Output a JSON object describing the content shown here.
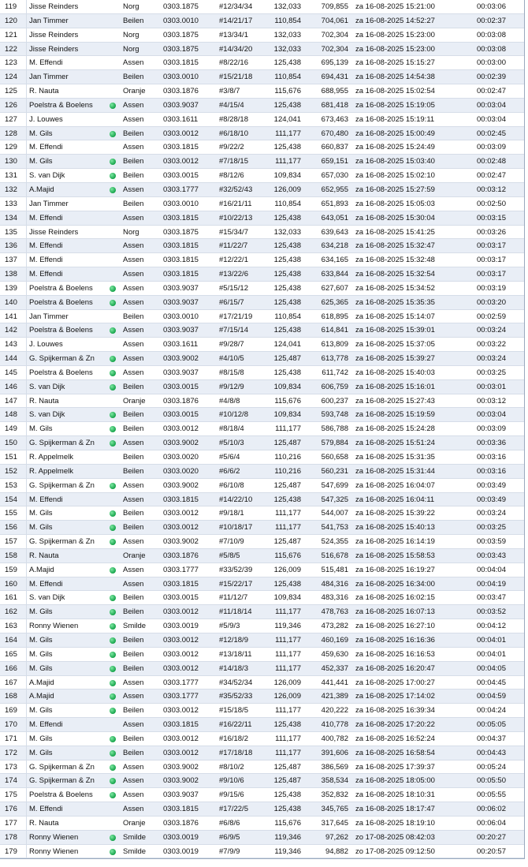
{
  "colors": {
    "row_alt": "#e9eef6",
    "row_base": "#ffffff",
    "dot": "#16a34a",
    "border": "#9aa9bf"
  },
  "icon": "green-dot-icon",
  "rows": [
    {
      "idx": "119",
      "name": "Jisse Reinders",
      "dot": false,
      "place": "Norg",
      "code": "0303.1875",
      "ring": "#12/34/34",
      "dist": "132,033",
      "speed": "709,855",
      "time": "za 16-08-2025 15:21:00",
      "dur": "00:03:06"
    },
    {
      "idx": "120",
      "name": "Jan Timmer",
      "dot": false,
      "place": "Beilen",
      "code": "0303.0010",
      "ring": "#14/21/17",
      "dist": "110,854",
      "speed": "704,061",
      "time": "za 16-08-2025 14:52:27",
      "dur": "00:02:37"
    },
    {
      "idx": "121",
      "name": "Jisse Reinders",
      "dot": false,
      "place": "Norg",
      "code": "0303.1875",
      "ring": "#13/34/1",
      "dist": "132,033",
      "speed": "702,304",
      "time": "za 16-08-2025 15:23:00",
      "dur": "00:03:08"
    },
    {
      "idx": "122",
      "name": "Jisse Reinders",
      "dot": false,
      "place": "Norg",
      "code": "0303.1875",
      "ring": "#14/34/20",
      "dist": "132,033",
      "speed": "702,304",
      "time": "za 16-08-2025 15:23:00",
      "dur": "00:03:08"
    },
    {
      "idx": "123",
      "name": "M. Effendi",
      "dot": false,
      "place": "Assen",
      "code": "0303.1815",
      "ring": "#8/22/16",
      "dist": "125,438",
      "speed": "695,139",
      "time": "za 16-08-2025 15:15:27",
      "dur": "00:03:00"
    },
    {
      "idx": "124",
      "name": "Jan Timmer",
      "dot": false,
      "place": "Beilen",
      "code": "0303.0010",
      "ring": "#15/21/18",
      "dist": "110,854",
      "speed": "694,431",
      "time": "za 16-08-2025 14:54:38",
      "dur": "00:02:39"
    },
    {
      "idx": "125",
      "name": "R. Nauta",
      "dot": false,
      "place": "Oranje",
      "code": "0303.1876",
      "ring": "#3/8/7",
      "dist": "115,676",
      "speed": "688,955",
      "time": "za 16-08-2025 15:02:54",
      "dur": "00:02:47"
    },
    {
      "idx": "126",
      "name": "Poelstra & Boelens",
      "dot": true,
      "place": "Assen",
      "code": "0303.9037",
      "ring": "#4/15/4",
      "dist": "125,438",
      "speed": "681,418",
      "time": "za 16-08-2025 15:19:05",
      "dur": "00:03:04"
    },
    {
      "idx": "127",
      "name": "J. Louwes",
      "dot": false,
      "place": "Assen",
      "code": "0303.1611",
      "ring": "#8/28/18",
      "dist": "124,041",
      "speed": "673,463",
      "time": "za 16-08-2025 15:19:11",
      "dur": "00:03:04"
    },
    {
      "idx": "128",
      "name": "M. Gils",
      "dot": true,
      "place": "Beilen",
      "code": "0303.0012",
      "ring": "#6/18/10",
      "dist": "111,177",
      "speed": "670,480",
      "time": "za 16-08-2025 15:00:49",
      "dur": "00:02:45"
    },
    {
      "idx": "129",
      "name": "M. Effendi",
      "dot": false,
      "place": "Assen",
      "code": "0303.1815",
      "ring": "#9/22/2",
      "dist": "125,438",
      "speed": "660,837",
      "time": "za 16-08-2025 15:24:49",
      "dur": "00:03:09"
    },
    {
      "idx": "130",
      "name": "M. Gils",
      "dot": true,
      "place": "Beilen",
      "code": "0303.0012",
      "ring": "#7/18/15",
      "dist": "111,177",
      "speed": "659,151",
      "time": "za 16-08-2025 15:03:40",
      "dur": "00:02:48"
    },
    {
      "idx": "131",
      "name": "S. van Dijk",
      "dot": true,
      "place": "Beilen",
      "code": "0303.0015",
      "ring": "#8/12/6",
      "dist": "109,834",
      "speed": "657,030",
      "time": "za 16-08-2025 15:02:10",
      "dur": "00:02:47"
    },
    {
      "idx": "132",
      "name": "A.Majid",
      "dot": true,
      "place": "Assen",
      "code": "0303.1777",
      "ring": "#32/52/43",
      "dist": "126,009",
      "speed": "652,955",
      "time": "za 16-08-2025 15:27:59",
      "dur": "00:03:12"
    },
    {
      "idx": "133",
      "name": "Jan Timmer",
      "dot": false,
      "place": "Beilen",
      "code": "0303.0010",
      "ring": "#16/21/11",
      "dist": "110,854",
      "speed": "651,893",
      "time": "za 16-08-2025 15:05:03",
      "dur": "00:02:50"
    },
    {
      "idx": "134",
      "name": "M. Effendi",
      "dot": false,
      "place": "Assen",
      "code": "0303.1815",
      "ring": "#10/22/13",
      "dist": "125,438",
      "speed": "643,051",
      "time": "za 16-08-2025 15:30:04",
      "dur": "00:03:15"
    },
    {
      "idx": "135",
      "name": "Jisse Reinders",
      "dot": false,
      "place": "Norg",
      "code": "0303.1875",
      "ring": "#15/34/7",
      "dist": "132,033",
      "speed": "639,643",
      "time": "za 16-08-2025 15:41:25",
      "dur": "00:03:26"
    },
    {
      "idx": "136",
      "name": "M. Effendi",
      "dot": false,
      "place": "Assen",
      "code": "0303.1815",
      "ring": "#11/22/7",
      "dist": "125,438",
      "speed": "634,218",
      "time": "za 16-08-2025 15:32:47",
      "dur": "00:03:17"
    },
    {
      "idx": "137",
      "name": "M. Effendi",
      "dot": false,
      "place": "Assen",
      "code": "0303.1815",
      "ring": "#12/22/1",
      "dist": "125,438",
      "speed": "634,165",
      "time": "za 16-08-2025 15:32:48",
      "dur": "00:03:17"
    },
    {
      "idx": "138",
      "name": "M. Effendi",
      "dot": false,
      "place": "Assen",
      "code": "0303.1815",
      "ring": "#13/22/6",
      "dist": "125,438",
      "speed": "633,844",
      "time": "za 16-08-2025 15:32:54",
      "dur": "00:03:17"
    },
    {
      "idx": "139",
      "name": "Poelstra & Boelens",
      "dot": true,
      "place": "Assen",
      "code": "0303.9037",
      "ring": "#5/15/12",
      "dist": "125,438",
      "speed": "627,607",
      "time": "za 16-08-2025 15:34:52",
      "dur": "00:03:19"
    },
    {
      "idx": "140",
      "name": "Poelstra & Boelens",
      "dot": true,
      "place": "Assen",
      "code": "0303.9037",
      "ring": "#6/15/7",
      "dist": "125,438",
      "speed": "625,365",
      "time": "za 16-08-2025 15:35:35",
      "dur": "00:03:20"
    },
    {
      "idx": "141",
      "name": "Jan Timmer",
      "dot": false,
      "place": "Beilen",
      "code": "0303.0010",
      "ring": "#17/21/19",
      "dist": "110,854",
      "speed": "618,895",
      "time": "za 16-08-2025 15:14:07",
      "dur": "00:02:59"
    },
    {
      "idx": "142",
      "name": "Poelstra & Boelens",
      "dot": true,
      "place": "Assen",
      "code": "0303.9037",
      "ring": "#7/15/14",
      "dist": "125,438",
      "speed": "614,841",
      "time": "za 16-08-2025 15:39:01",
      "dur": "00:03:24"
    },
    {
      "idx": "143",
      "name": "J. Louwes",
      "dot": false,
      "place": "Assen",
      "code": "0303.1611",
      "ring": "#9/28/7",
      "dist": "124,041",
      "speed": "613,809",
      "time": "za 16-08-2025 15:37:05",
      "dur": "00:03:22"
    },
    {
      "idx": "144",
      "name": "G. Spijkerman & Zn",
      "dot": true,
      "place": "Assen",
      "code": "0303.9002",
      "ring": "#4/10/5",
      "dist": "125,487",
      "speed": "613,778",
      "time": "za 16-08-2025 15:39:27",
      "dur": "00:03:24"
    },
    {
      "idx": "145",
      "name": "Poelstra & Boelens",
      "dot": true,
      "place": "Assen",
      "code": "0303.9037",
      "ring": "#8/15/8",
      "dist": "125,438",
      "speed": "611,742",
      "time": "za 16-08-2025 15:40:03",
      "dur": "00:03:25"
    },
    {
      "idx": "146",
      "name": "S. van Dijk",
      "dot": true,
      "place": "Beilen",
      "code": "0303.0015",
      "ring": "#9/12/9",
      "dist": "109,834",
      "speed": "606,759",
      "time": "za 16-08-2025 15:16:01",
      "dur": "00:03:01"
    },
    {
      "idx": "147",
      "name": "R. Nauta",
      "dot": false,
      "place": "Oranje",
      "code": "0303.1876",
      "ring": "#4/8/8",
      "dist": "115,676",
      "speed": "600,237",
      "time": "za 16-08-2025 15:27:43",
      "dur": "00:03:12"
    },
    {
      "idx": "148",
      "name": "S. van Dijk",
      "dot": true,
      "place": "Beilen",
      "code": "0303.0015",
      "ring": "#10/12/8",
      "dist": "109,834",
      "speed": "593,748",
      "time": "za 16-08-2025 15:19:59",
      "dur": "00:03:04"
    },
    {
      "idx": "149",
      "name": "M. Gils",
      "dot": true,
      "place": "Beilen",
      "code": "0303.0012",
      "ring": "#8/18/4",
      "dist": "111,177",
      "speed": "586,788",
      "time": "za 16-08-2025 15:24:28",
      "dur": "00:03:09"
    },
    {
      "idx": "150",
      "name": "G. Spijkerman & Zn",
      "dot": true,
      "place": "Assen",
      "code": "0303.9002",
      "ring": "#5/10/3",
      "dist": "125,487",
      "speed": "579,884",
      "time": "za 16-08-2025 15:51:24",
      "dur": "00:03:36"
    },
    {
      "idx": "151",
      "name": "R. Appelmelk",
      "dot": false,
      "place": "Beilen",
      "code": "0303.0020",
      "ring": "#5/6/4",
      "dist": "110,216",
      "speed": "560,658",
      "time": "za 16-08-2025 15:31:35",
      "dur": "00:03:16"
    },
    {
      "idx": "152",
      "name": "R. Appelmelk",
      "dot": false,
      "place": "Beilen",
      "code": "0303.0020",
      "ring": "#6/6/2",
      "dist": "110,216",
      "speed": "560,231",
      "time": "za 16-08-2025 15:31:44",
      "dur": "00:03:16"
    },
    {
      "idx": "153",
      "name": "G. Spijkerman & Zn",
      "dot": true,
      "place": "Assen",
      "code": "0303.9002",
      "ring": "#6/10/8",
      "dist": "125,487",
      "speed": "547,699",
      "time": "za 16-08-2025 16:04:07",
      "dur": "00:03:49"
    },
    {
      "idx": "154",
      "name": "M. Effendi",
      "dot": false,
      "place": "Assen",
      "code": "0303.1815",
      "ring": "#14/22/10",
      "dist": "125,438",
      "speed": "547,325",
      "time": "za 16-08-2025 16:04:11",
      "dur": "00:03:49"
    },
    {
      "idx": "155",
      "name": "M. Gils",
      "dot": true,
      "place": "Beilen",
      "code": "0303.0012",
      "ring": "#9/18/1",
      "dist": "111,177",
      "speed": "544,007",
      "time": "za 16-08-2025 15:39:22",
      "dur": "00:03:24"
    },
    {
      "idx": "156",
      "name": "M. Gils",
      "dot": true,
      "place": "Beilen",
      "code": "0303.0012",
      "ring": "#10/18/17",
      "dist": "111,177",
      "speed": "541,753",
      "time": "za 16-08-2025 15:40:13",
      "dur": "00:03:25"
    },
    {
      "idx": "157",
      "name": "G. Spijkerman & Zn",
      "dot": true,
      "place": "Assen",
      "code": "0303.9002",
      "ring": "#7/10/9",
      "dist": "125,487",
      "speed": "524,355",
      "time": "za 16-08-2025 16:14:19",
      "dur": "00:03:59"
    },
    {
      "idx": "158",
      "name": "R. Nauta",
      "dot": false,
      "place": "Oranje",
      "code": "0303.1876",
      "ring": "#5/8/5",
      "dist": "115,676",
      "speed": "516,678",
      "time": "za 16-08-2025 15:58:53",
      "dur": "00:03:43"
    },
    {
      "idx": "159",
      "name": "A.Majid",
      "dot": true,
      "place": "Assen",
      "code": "0303.1777",
      "ring": "#33/52/39",
      "dist": "126,009",
      "speed": "515,481",
      "time": "za 16-08-2025 16:19:27",
      "dur": "00:04:04"
    },
    {
      "idx": "160",
      "name": "M. Effendi",
      "dot": false,
      "place": "Assen",
      "code": "0303.1815",
      "ring": "#15/22/17",
      "dist": "125,438",
      "speed": "484,316",
      "time": "za 16-08-2025 16:34:00",
      "dur": "00:04:19"
    },
    {
      "idx": "161",
      "name": "S. van Dijk",
      "dot": true,
      "place": "Beilen",
      "code": "0303.0015",
      "ring": "#11/12/7",
      "dist": "109,834",
      "speed": "483,316",
      "time": "za 16-08-2025 16:02:15",
      "dur": "00:03:47"
    },
    {
      "idx": "162",
      "name": "M. Gils",
      "dot": true,
      "place": "Beilen",
      "code": "0303.0012",
      "ring": "#11/18/14",
      "dist": "111,177",
      "speed": "478,763",
      "time": "za 16-08-2025 16:07:13",
      "dur": "00:03:52"
    },
    {
      "idx": "163",
      "name": "Ronny Wienen",
      "dot": true,
      "place": "Smilde",
      "code": "0303.0019",
      "ring": "#5/9/3",
      "dist": "119,346",
      "speed": "473,282",
      "time": "za 16-08-2025 16:27:10",
      "dur": "00:04:12"
    },
    {
      "idx": "164",
      "name": "M. Gils",
      "dot": true,
      "place": "Beilen",
      "code": "0303.0012",
      "ring": "#12/18/9",
      "dist": "111,177",
      "speed": "460,169",
      "time": "za 16-08-2025 16:16:36",
      "dur": "00:04:01"
    },
    {
      "idx": "165",
      "name": "M. Gils",
      "dot": true,
      "place": "Beilen",
      "code": "0303.0012",
      "ring": "#13/18/11",
      "dist": "111,177",
      "speed": "459,630",
      "time": "za 16-08-2025 16:16:53",
      "dur": "00:04:01"
    },
    {
      "idx": "166",
      "name": "M. Gils",
      "dot": true,
      "place": "Beilen",
      "code": "0303.0012",
      "ring": "#14/18/3",
      "dist": "111,177",
      "speed": "452,337",
      "time": "za 16-08-2025 16:20:47",
      "dur": "00:04:05"
    },
    {
      "idx": "167",
      "name": "A.Majid",
      "dot": true,
      "place": "Assen",
      "code": "0303.1777",
      "ring": "#34/52/34",
      "dist": "126,009",
      "speed": "441,441",
      "time": "za 16-08-2025 17:00:27",
      "dur": "00:04:45"
    },
    {
      "idx": "168",
      "name": "A.Majid",
      "dot": true,
      "place": "Assen",
      "code": "0303.1777",
      "ring": "#35/52/33",
      "dist": "126,009",
      "speed": "421,389",
      "time": "za 16-08-2025 17:14:02",
      "dur": "00:04:59"
    },
    {
      "idx": "169",
      "name": "M. Gils",
      "dot": true,
      "place": "Beilen",
      "code": "0303.0012",
      "ring": "#15/18/5",
      "dist": "111,177",
      "speed": "420,222",
      "time": "za 16-08-2025 16:39:34",
      "dur": "00:04:24"
    },
    {
      "idx": "170",
      "name": "M. Effendi",
      "dot": false,
      "place": "Assen",
      "code": "0303.1815",
      "ring": "#16/22/11",
      "dist": "125,438",
      "speed": "410,778",
      "time": "za 16-08-2025 17:20:22",
      "dur": "00:05:05"
    },
    {
      "idx": "171",
      "name": "M. Gils",
      "dot": true,
      "place": "Beilen",
      "code": "0303.0012",
      "ring": "#16/18/2",
      "dist": "111,177",
      "speed": "400,782",
      "time": "za 16-08-2025 16:52:24",
      "dur": "00:04:37"
    },
    {
      "idx": "172",
      "name": "M. Gils",
      "dot": true,
      "place": "Beilen",
      "code": "0303.0012",
      "ring": "#17/18/18",
      "dist": "111,177",
      "speed": "391,606",
      "time": "za 16-08-2025 16:58:54",
      "dur": "00:04:43"
    },
    {
      "idx": "173",
      "name": "G. Spijkerman & Zn",
      "dot": true,
      "place": "Assen",
      "code": "0303.9002",
      "ring": "#8/10/2",
      "dist": "125,487",
      "speed": "386,569",
      "time": "za 16-08-2025 17:39:37",
      "dur": "00:05:24"
    },
    {
      "idx": "174",
      "name": "G. Spijkerman & Zn",
      "dot": true,
      "place": "Assen",
      "code": "0303.9002",
      "ring": "#9/10/6",
      "dist": "125,487",
      "speed": "358,534",
      "time": "za 16-08-2025 18:05:00",
      "dur": "00:05:50"
    },
    {
      "idx": "175",
      "name": "Poelstra & Boelens",
      "dot": true,
      "place": "Assen",
      "code": "0303.9037",
      "ring": "#9/15/6",
      "dist": "125,438",
      "speed": "352,832",
      "time": "za 16-08-2025 18:10:31",
      "dur": "00:05:55"
    },
    {
      "idx": "176",
      "name": "M. Effendi",
      "dot": false,
      "place": "Assen",
      "code": "0303.1815",
      "ring": "#17/22/5",
      "dist": "125,438",
      "speed": "345,765",
      "time": "za 16-08-2025 18:17:47",
      "dur": "00:06:02"
    },
    {
      "idx": "177",
      "name": "R. Nauta",
      "dot": false,
      "place": "Oranje",
      "code": "0303.1876",
      "ring": "#6/8/6",
      "dist": "115,676",
      "speed": "317,645",
      "time": "za 16-08-2025 18:19:10",
      "dur": "00:06:04"
    },
    {
      "idx": "178",
      "name": "Ronny Wienen",
      "dot": true,
      "place": "Smilde",
      "code": "0303.0019",
      "ring": "#6/9/5",
      "dist": "119,346",
      "speed": "97,262",
      "time": "zo 17-08-2025 08:42:03",
      "dur": "00:20:27"
    },
    {
      "idx": "179",
      "name": "Ronny Wienen",
      "dot": true,
      "place": "Smilde",
      "code": "0303.0019",
      "ring": "#7/9/9",
      "dist": "119,346",
      "speed": "94,882",
      "time": "zo 17-08-2025 09:12:50",
      "dur": "00:20:57"
    }
  ]
}
